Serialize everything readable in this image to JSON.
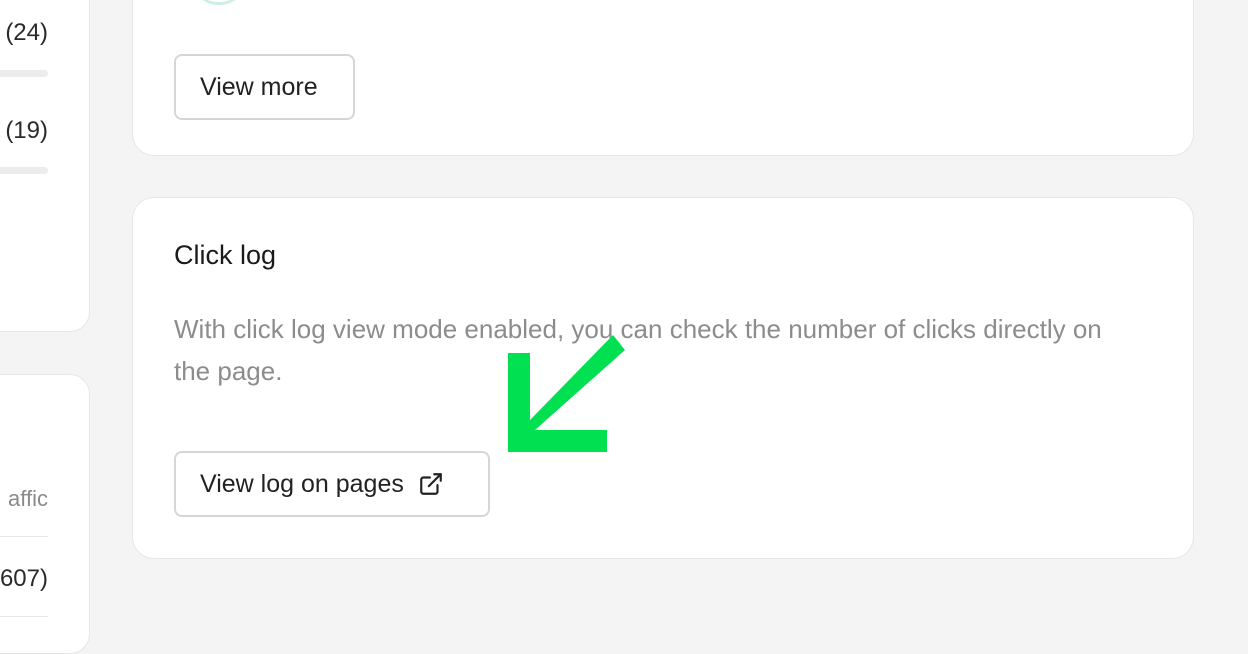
{
  "left_panel": {
    "counts": [
      "(24)",
      "(19)"
    ],
    "traffic_label": "affic",
    "bottom_count": "607)"
  },
  "upper_card": {
    "view_more_label": "View more"
  },
  "click_log": {
    "title": "Click log",
    "description": "With click log view mode enabled, you can check the number of clicks directly on the page.",
    "button_label": "View log on pages",
    "button_icon": "external-link-icon"
  },
  "annotation": {
    "arrow_color": "#00e050"
  }
}
